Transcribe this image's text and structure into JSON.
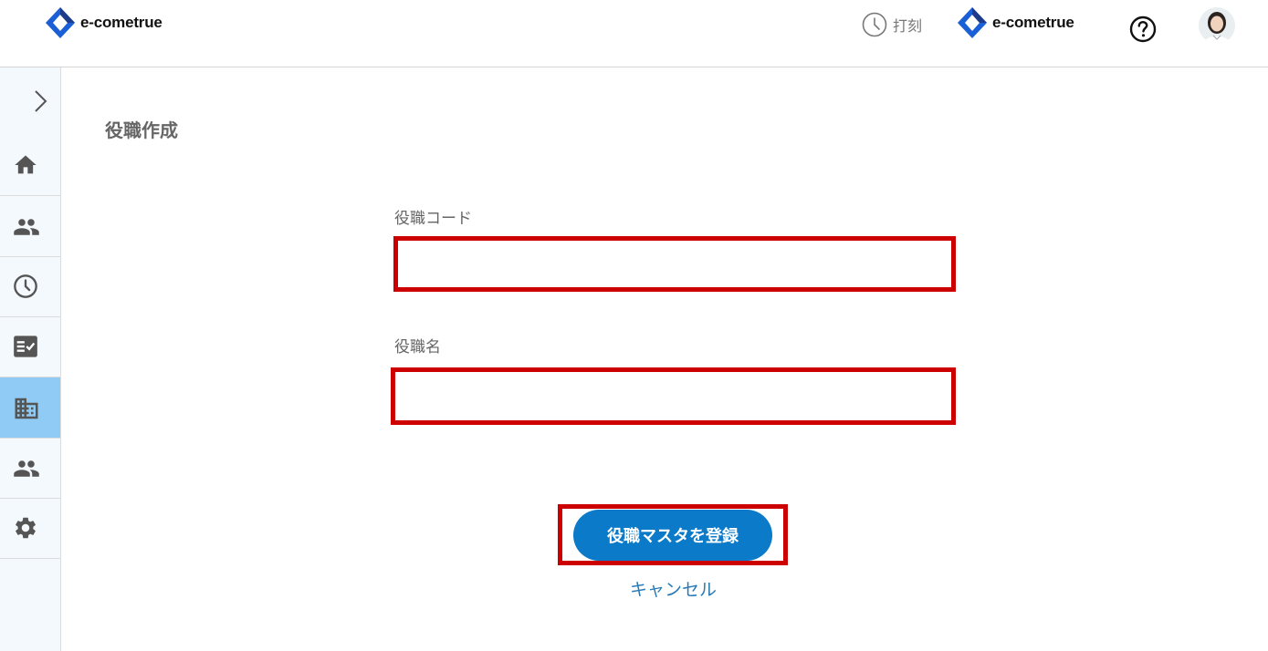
{
  "header": {
    "brand_left": "e-cometrue",
    "brand_right": "e-cometrue",
    "clock_in_label": "打刻",
    "icons": [
      "clock-icon",
      "help-icon",
      "avatar"
    ],
    "colors": {
      "brand_blue": "#1a5fd6",
      "brand_dark": "#1e3a8a"
    }
  },
  "sidebar": {
    "expand_icon": "chevron-right-icon",
    "items": [
      {
        "icon": "home-icon",
        "active": false
      },
      {
        "icon": "people-icon",
        "active": false
      },
      {
        "icon": "clock-icon",
        "active": false
      },
      {
        "icon": "task-checklist-icon",
        "active": false
      },
      {
        "icon": "building-icon",
        "active": true
      },
      {
        "icon": "group-icon",
        "active": false
      },
      {
        "icon": "settings-gear-icon",
        "active": false
      }
    ],
    "colors": {
      "background": "#f4f9fd",
      "active": "#8fcbf4",
      "icon": "#555555"
    }
  },
  "main": {
    "title": "役職作成",
    "form": {
      "code_label": "役職コード",
      "code_value": "",
      "name_label": "役職名",
      "name_value": "",
      "submit_label": "役職マスタを登録",
      "cancel_label": "キャンセル"
    },
    "colors": {
      "primary": "#0a7ac9",
      "highlight_border": "#cc0000",
      "link": "#2a7ab5"
    }
  }
}
